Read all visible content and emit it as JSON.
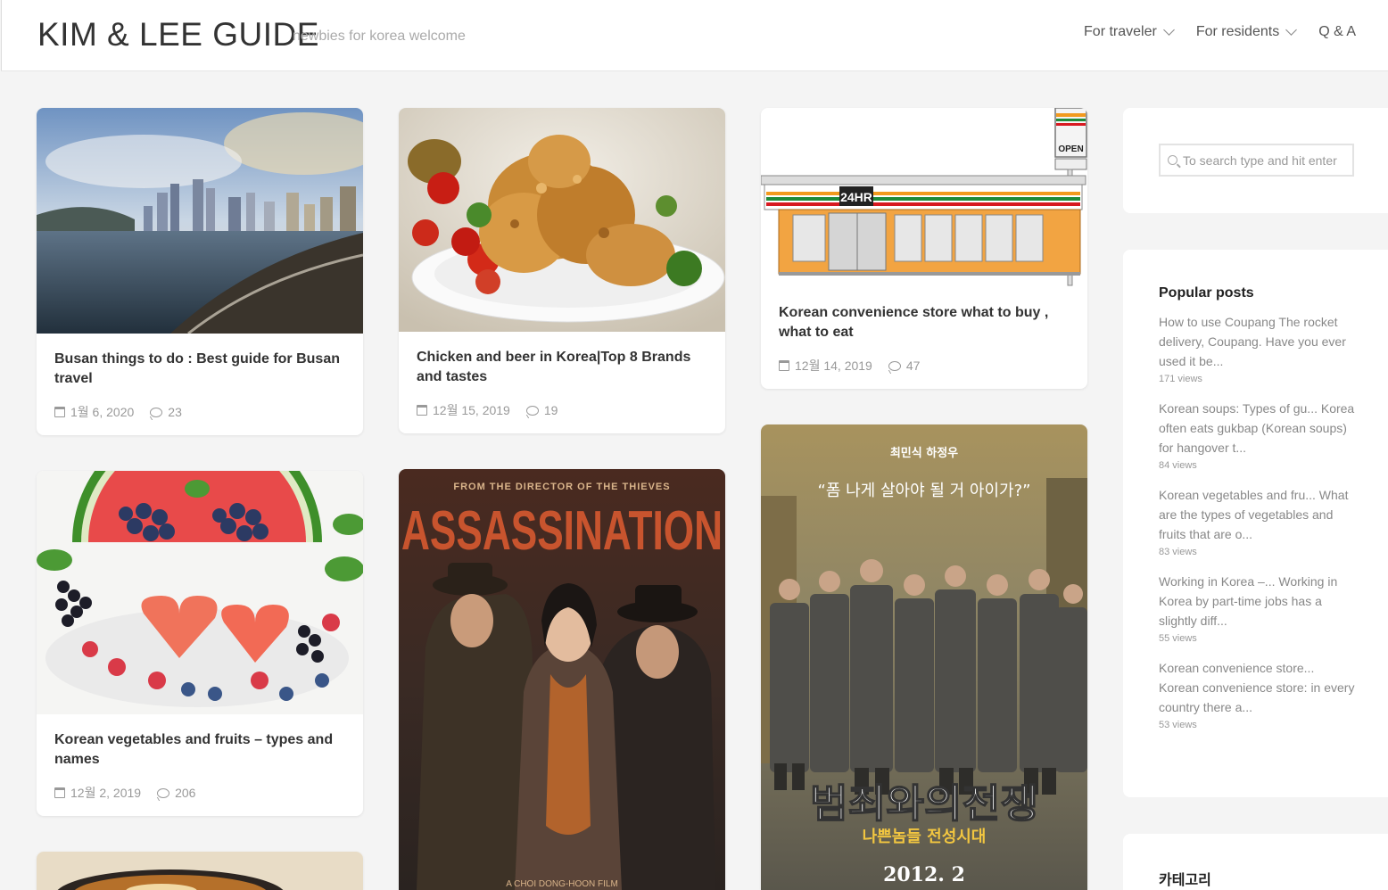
{
  "header": {
    "brand": "KIM & LEE GUIDE",
    "tagline": "newbies for korea welcome",
    "nav": [
      {
        "label": "For traveler"
      },
      {
        "label": "For residents"
      },
      {
        "label": "Q & A"
      }
    ]
  },
  "posts": [
    {
      "title": "Busan things to do : Best guide for Busan travel",
      "date": "1월 6, 2020",
      "comments": "23"
    },
    {
      "title": "Chicken and beer in Korea|Top 8 Brands and tastes",
      "date": "12월 15, 2019",
      "comments": "19"
    },
    {
      "title": "Korean convenience store what to buy , what to eat",
      "date": "12월 14, 2019",
      "comments": "47"
    },
    {
      "title": "Korean vegetables and fruits – types and names",
      "date": "12월 2, 2019",
      "comments": "206"
    },
    {
      "poster_top": "FROM THE DIRECTOR OF THE THIEVES",
      "poster_title": "ASSASSINATION",
      "poster_credit": "A CHOI DONG-HOON FILM"
    },
    {
      "poster_names": "최민식   하정우",
      "poster_quote": "“폼 나게 살아야 될 거 아이가?”",
      "poster_title": "범죄와의전쟁",
      "poster_subtitle": "나쁜놈들 전성시대",
      "poster_date": "2012. 2"
    }
  ],
  "store": {
    "sign": "24HR",
    "open": "OPEN"
  },
  "sidebar": {
    "search_placeholder": "To search type and hit enter",
    "popular_title": "Popular posts",
    "popular": [
      {
        "text": "How to use Coupang The rocket delivery, Coupang. Have you ever used it be...",
        "views": "171 views"
      },
      {
        "text": "Korean soups: Types of gu... Korea often eats gukbap (Korean soups) for hangover t...",
        "views": "84 views"
      },
      {
        "text": "Korean vegetables and fru... What are the types of vegetables and fruits that are o...",
        "views": "83 views"
      },
      {
        "text": "Working in Korea –... Working in Korea by part-time jobs has a slightly diff...",
        "views": "55 views"
      },
      {
        "text": "Korean convenience store... Korean convenience store: in every country there a...",
        "views": "53 views"
      }
    ],
    "category_title": "카테고리"
  },
  "colors": {
    "accent": "#333333",
    "muted": "#999999",
    "background": "#f4f4f4"
  }
}
